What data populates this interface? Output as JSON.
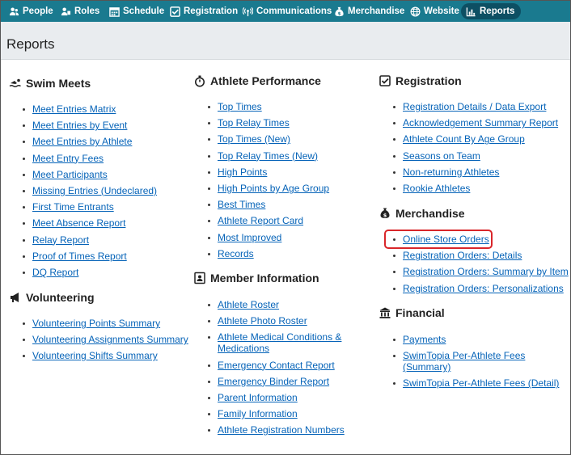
{
  "nav": {
    "items": [
      {
        "label": "People",
        "icon": "people-icon"
      },
      {
        "label": "Roles",
        "icon": "roles-icon"
      },
      {
        "label": "Schedule",
        "icon": "calendar-icon"
      },
      {
        "label": "Registration",
        "icon": "checkbox-icon"
      },
      {
        "label": "Communications",
        "icon": "broadcast-icon"
      },
      {
        "label": "Merchandise",
        "icon": "money-bag-icon"
      },
      {
        "label": "Website",
        "icon": "globe-icon"
      },
      {
        "label": "Reports",
        "icon": "bar-chart-icon",
        "active": true
      }
    ]
  },
  "page": {
    "title": "Reports"
  },
  "sections": {
    "swim_meets": {
      "title": "Swim Meets",
      "links": [
        "Meet Entries Matrix",
        "Meet Entries by Event",
        "Meet Entries by Athlete",
        "Meet Entry Fees",
        "Meet Participants",
        "Missing Entries (Undeclared)",
        "First Time Entrants",
        "Meet Absence Report",
        "Relay Report",
        "Proof of Times Report",
        "DQ Report"
      ]
    },
    "volunteering": {
      "title": "Volunteering",
      "links": [
        "Volunteering Points Summary",
        "Volunteering Assignments Summary",
        "Volunteering Shifts Summary"
      ]
    },
    "athlete_performance": {
      "title": "Athlete Performance",
      "links": [
        "Top Times",
        "Top Relay Times",
        "Top Times (New)",
        "Top Relay Times (New)",
        "High Points",
        "High Points by Age Group",
        "Best Times",
        "Athlete Report Card",
        "Most Improved",
        "Records"
      ]
    },
    "member_information": {
      "title": "Member Information",
      "links": [
        "Athlete Roster",
        "Athlete Photo Roster",
        "Athlete Medical Conditions & Medications",
        "Emergency Contact Report",
        "Emergency Binder Report",
        "Parent Information",
        "Family Information",
        "Athlete Registration Numbers"
      ]
    },
    "registration": {
      "title": "Registration",
      "links": [
        "Registration Details / Data Export",
        "Acknowledgement Summary Report",
        "Athlete Count By Age Group",
        "Seasons on Team",
        "Non-returning Athletes",
        "Rookie Athletes"
      ]
    },
    "merchandise": {
      "title": "Merchandise",
      "links": [
        "Online Store Orders",
        "Registration Orders: Details",
        "Registration Orders: Summary by Item",
        "Registration Orders: Personalizations"
      ]
    },
    "financial": {
      "title": "Financial",
      "links": [
        "Payments",
        "SwimTopia Per-Athlete Fees (Summary)",
        "SwimTopia Per-Athlete Fees (Detail)"
      ]
    }
  }
}
